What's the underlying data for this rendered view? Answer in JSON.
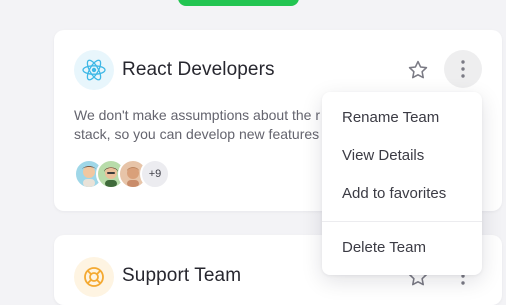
{
  "cards": [
    {
      "name": "React Developers",
      "description_line1": "We don't make assumptions about the r",
      "description_line2": "stack, so you can develop new features",
      "extra_members": "+9"
    },
    {
      "name": "Support Team"
    }
  ],
  "menu": {
    "items": [
      "Rename Team",
      "View Details",
      "Add to favorites"
    ],
    "danger_item": "Delete Team"
  },
  "colors": {
    "accent_green": "#23c552",
    "react_blue": "#3fb8e6",
    "support_orange": "#f4a931"
  }
}
